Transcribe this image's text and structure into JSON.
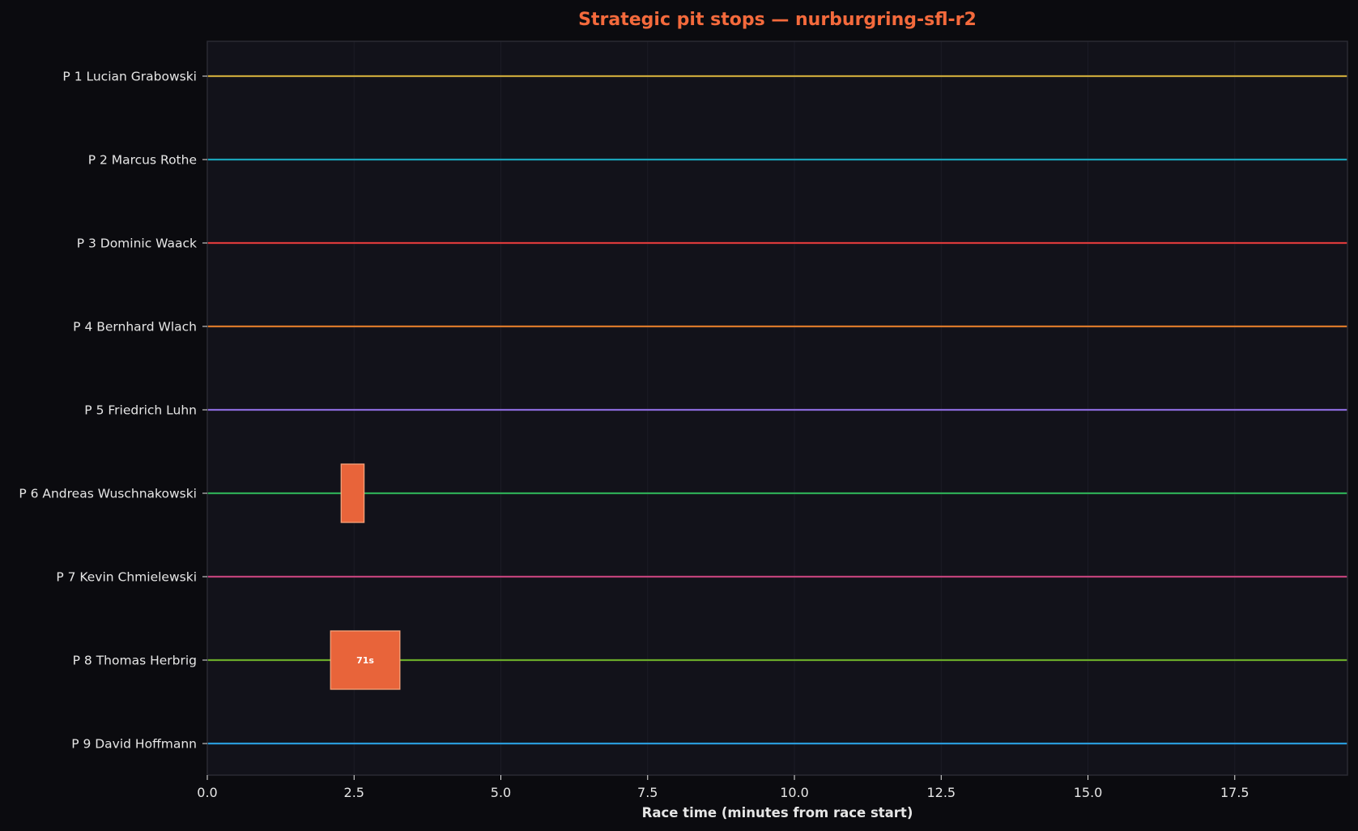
{
  "theme": {
    "background": "#0b0b0f",
    "plot_background": "#12121a",
    "plot_border": "#2a2a33",
    "grid": "#1c1c26",
    "text": "#e6e6e6",
    "title_color": "#f46a3c",
    "pit_fill": "#e8643a",
    "pit_edge": "#f6a27a",
    "pit_label_color": "#ffffff"
  },
  "chart_data": {
    "type": "timeline",
    "title": "Strategic pit stops — nurburgring-sfl-r2",
    "xlabel": "Race time (minutes from race start)",
    "ylabel": "",
    "xlim": [
      0,
      19.42
    ],
    "xticks": [
      0,
      2.5,
      5,
      7.5,
      10,
      12.5,
      15,
      17.5
    ],
    "xtick_labels": [
      "0.0",
      "2.5",
      "5.0",
      "7.5",
      "10.0",
      "12.5",
      "15.0",
      "17.5"
    ],
    "grid": true,
    "drivers": [
      {
        "label": "P 1 Lucian Grabowski",
        "color": "#c8a63a",
        "pits": []
      },
      {
        "label": "P 2 Marcus Rothe",
        "color": "#1aa3b8",
        "pits": []
      },
      {
        "label": "P 3 Dominic Waack",
        "color": "#d93a3a",
        "pits": []
      },
      {
        "label": "P 4 Bernhard Wlach",
        "color": "#d9782a",
        "pits": []
      },
      {
        "label": "P 5 Friedrich Luhn",
        "color": "#8a6ad9",
        "pits": []
      },
      {
        "label": "P 6 Andreas Wuschnakowski",
        "color": "#2eaa55",
        "pits": [
          {
            "start": 2.28,
            "end": 2.67,
            "duration_label": ""
          }
        ]
      },
      {
        "label": "P 7 Kevin Chmielewski",
        "color": "#c0427a",
        "pits": []
      },
      {
        "label": "P 8 Thomas Herbrig",
        "color": "#6aaa2a",
        "pits": [
          {
            "start": 2.1,
            "end": 3.28,
            "duration_label": "71s"
          }
        ]
      },
      {
        "label": "P 9 David Hoffmann",
        "color": "#2a9ad9",
        "pits": []
      }
    ]
  }
}
